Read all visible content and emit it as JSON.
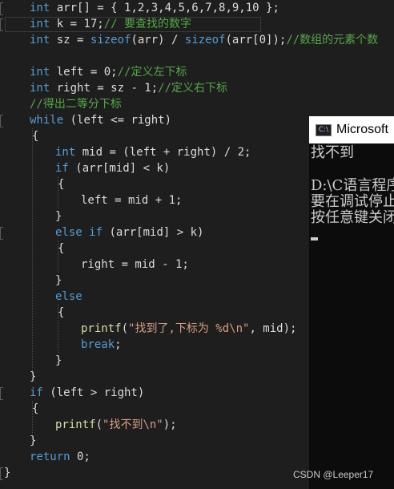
{
  "editor": {
    "lines": [
      [
        [
          "kw",
          "int"
        ],
        [
          "pl",
          " arr[] = { 1,2,3,4,5,6,7,8,9,10 };"
        ]
      ],
      [
        [
          "kw",
          "int"
        ],
        [
          "pl",
          " k = 17;"
        ],
        [
          "cm",
          "// 要查找的数字"
        ]
      ],
      [
        [
          "kw",
          "int"
        ],
        [
          "pl",
          " sz = "
        ],
        [
          "kw",
          "sizeof"
        ],
        [
          "pl",
          "(arr) / "
        ],
        [
          "kw",
          "sizeof"
        ],
        [
          "pl",
          "(arr[0]);"
        ],
        [
          "cm",
          "//数组的元素个数"
        ]
      ],
      [],
      [
        [
          "kw",
          "int"
        ],
        [
          "pl",
          " left = 0;"
        ],
        [
          "cm",
          "//定义左下标"
        ]
      ],
      [
        [
          "kw",
          "int"
        ],
        [
          "pl",
          " right = sz - 1;"
        ],
        [
          "cm",
          "//定义右下标"
        ]
      ],
      [
        [
          "cm",
          "//得出二等分下标"
        ]
      ],
      [
        [
          "kw",
          "while"
        ],
        [
          "pl",
          " (left <= right)"
        ]
      ],
      [
        [
          "pl",
          "{"
        ]
      ],
      [
        [
          "kw",
          "int"
        ],
        [
          "pl",
          " mid = (left + right) / 2;"
        ]
      ],
      [
        [
          "kw",
          "if"
        ],
        [
          "pl",
          " (arr[mid] < k)"
        ]
      ],
      [
        [
          "pl",
          "{"
        ]
      ],
      [
        [
          "pl",
          "left = mid + 1;"
        ]
      ],
      [
        [
          "pl",
          "}"
        ]
      ],
      [
        [
          "kw",
          "else if"
        ],
        [
          "pl",
          " (arr[mid] > k)"
        ]
      ],
      [
        [
          "pl",
          "{"
        ]
      ],
      [
        [
          "pl",
          "right = mid - 1;"
        ]
      ],
      [
        [
          "pl",
          "}"
        ]
      ],
      [
        [
          "kw",
          "else"
        ]
      ],
      [
        [
          "pl",
          "{"
        ]
      ],
      [
        [
          "fn",
          "printf"
        ],
        [
          "pl",
          "("
        ],
        [
          "st",
          "\"找到了,下标为 %d\\n\""
        ],
        [
          "pl",
          ", mid);"
        ]
      ],
      [
        [
          "kw",
          "break"
        ],
        [
          "pl",
          ";"
        ]
      ],
      [
        [
          "pl",
          "}"
        ]
      ],
      [
        [
          "pl",
          "}"
        ]
      ],
      [
        [
          "kw",
          "if"
        ],
        [
          "pl",
          " (left > right)"
        ]
      ],
      [
        [
          "pl",
          "{"
        ]
      ],
      [
        [
          "fn",
          "printf"
        ],
        [
          "pl",
          "("
        ],
        [
          "st",
          "\"找不到\\n\""
        ],
        [
          "pl",
          ");"
        ]
      ],
      [
        [
          "pl",
          "}"
        ]
      ],
      [
        [
          "kw",
          "return"
        ],
        [
          "pl",
          " 0;"
        ]
      ],
      [
        [
          "pl",
          "}"
        ]
      ]
    ]
  },
  "console": {
    "title": "Microsoft",
    "icon_text": "C:\\",
    "output_lines": [
      "找不到",
      "",
      "D:\\C语言程序",
      "要在调试停止",
      "按任意键关闭"
    ]
  },
  "watermark": "CSDN @Leeper17",
  "colors": {
    "background": "#1e1e1e",
    "keyword": "#569cd6",
    "comment": "#57a64a",
    "string": "#d69d85",
    "function": "#dcdcaa",
    "text": "#dcdcdc",
    "console_bg": "#0c0c0c"
  }
}
